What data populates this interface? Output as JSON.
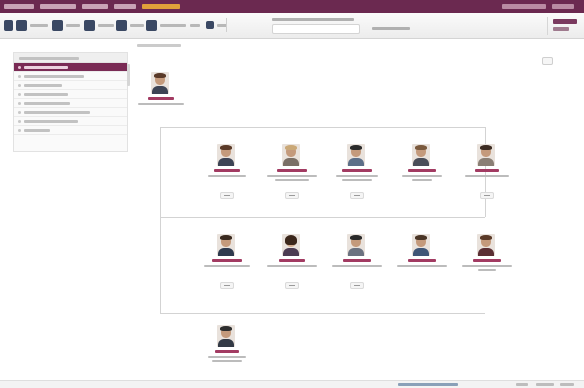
{
  "app": {
    "nav": {
      "items": [
        {
          "name": "nav-item-1"
        },
        {
          "name": "nav-item-2"
        },
        {
          "name": "nav-item-3"
        },
        {
          "name": "nav-item-4"
        },
        {
          "name": "nav-item-5",
          "active": true
        }
      ],
      "right_items": [
        {
          "name": "nav-right-item-1"
        },
        {
          "name": "nav-right-item-2"
        }
      ]
    },
    "toolbar": {
      "buttons": [
        {
          "icon": "home-icon"
        },
        {
          "icon": "people-icon"
        },
        {
          "icon": "folder-icon"
        },
        {
          "icon": "document-icon"
        },
        {
          "icon": "printer-icon"
        },
        {
          "icon": "export-icon"
        },
        {
          "icon": "settings-icon"
        }
      ]
    },
    "sidebar": {
      "items": [
        {
          "active": true
        },
        {
          "active": false
        },
        {
          "active": false
        },
        {
          "active": false
        },
        {
          "active": false
        },
        {
          "active": false
        },
        {
          "active": false
        },
        {
          "active": false
        },
        {
          "active": false
        }
      ]
    },
    "org_chart": {
      "root": {
        "photo": "person-photo"
      },
      "rows": [
        [
          {
            "photo": "person-photo"
          },
          {
            "photo": "person-photo"
          },
          {
            "photo": "person-photo"
          },
          {
            "photo": "person-photo"
          },
          {
            "photo": "person-photo"
          }
        ],
        [
          {
            "photo": "person-photo"
          },
          {
            "photo": "person-photo"
          },
          {
            "photo": "person-photo"
          },
          {
            "photo": "person-photo"
          },
          {
            "photo": "person-photo"
          }
        ],
        [
          {
            "photo": "person-photo"
          }
        ]
      ]
    },
    "colors": {
      "topbar": "#6b2950",
      "accent": "#a23b62",
      "active_nav": "#e0a13a",
      "sidebar_active": "#7a2b55"
    }
  }
}
